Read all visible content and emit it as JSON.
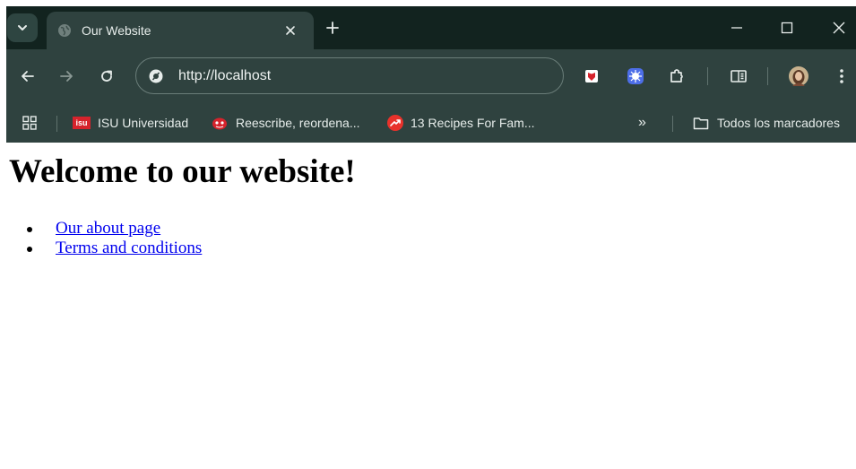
{
  "browser": {
    "tab": {
      "title": "Our Website"
    },
    "address_bar": {
      "url": "http://localhost"
    },
    "bookmarks": [
      {
        "label": "ISU Universidad",
        "icon": "isu-logo-icon",
        "icon_text": "isu"
      },
      {
        "label": "Reescribe, reordena...",
        "icon": "red-face-icon"
      },
      {
        "label": "13 Recipes For Fam...",
        "icon": "trending-arrow-icon"
      }
    ],
    "overflow_label": "»",
    "all_bookmarks_label": "Todos los marcadores",
    "colors": {
      "frame": "#12231f",
      "toolbar": "#2f423f",
      "text": "#e6ecea",
      "extension_red": "#d6232c",
      "extension_blue": "#4d6ee8"
    }
  },
  "page": {
    "heading": "Welcome to our website!",
    "links": [
      {
        "label": "Our about page"
      },
      {
        "label": "Terms and conditions"
      }
    ],
    "link_color": "#0000ee"
  }
}
